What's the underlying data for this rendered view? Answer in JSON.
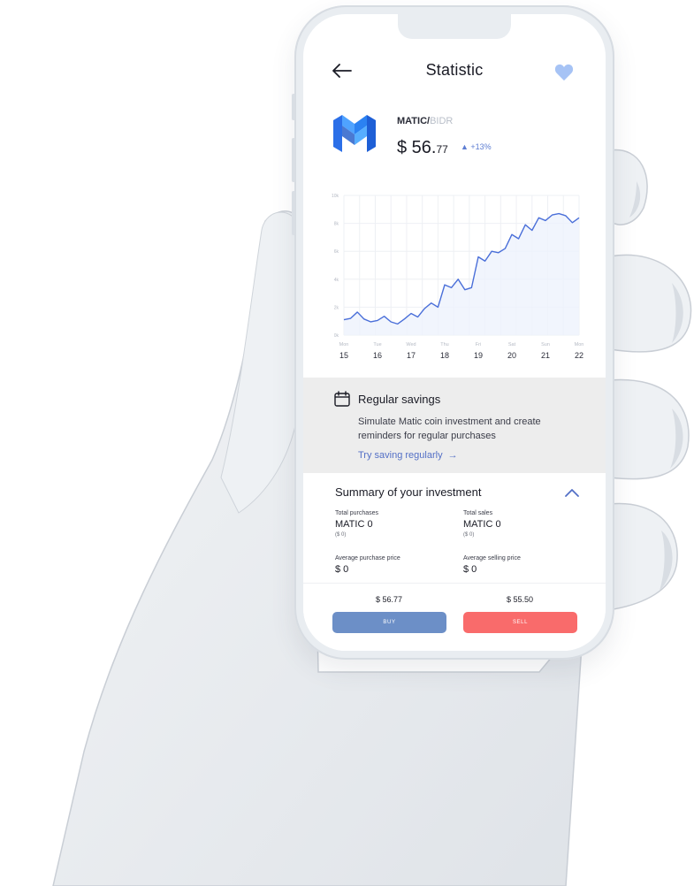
{
  "header": {
    "title": "Statistic",
    "back_icon": "arrow-left-icon",
    "favorite_icon": "heart-icon"
  },
  "coin": {
    "logo_icon": "matic-logo-icon",
    "base": "MATIC",
    "separator": "/",
    "quote": "BIDR",
    "price_main": "$ 56.",
    "price_decimal": "77",
    "change": "▲ +13%"
  },
  "chart_data": {
    "type": "line",
    "x": [
      "Mon 15",
      "Tue 16",
      "Wed 17",
      "Thu 18",
      "Fri 19",
      "Sat 20",
      "Sun 21",
      "Mon 22"
    ],
    "weekday_labels": [
      "Mon",
      "Tue",
      "Wed",
      "Thu",
      "Fri",
      "Sat",
      "Sun",
      "Mon"
    ],
    "day_labels": [
      "15",
      "16",
      "17",
      "18",
      "19",
      "20",
      "21",
      "22"
    ],
    "y_tick_labels": [
      "0k",
      "2k",
      "4k",
      "6k",
      "8k",
      "10k"
    ],
    "ylim": [
      0,
      10000
    ],
    "series": [
      {
        "color": "#4a6fd9",
        "x": [
          0,
          0.2,
          0.4,
          0.6,
          0.8,
          1.0,
          1.2,
          1.4,
          1.6,
          1.8,
          2.0,
          2.2,
          2.4,
          2.6,
          2.8,
          3.0,
          3.2,
          3.4,
          3.6,
          3.8,
          4.0,
          4.2,
          4.4,
          4.6,
          4.8,
          5.0,
          5.2,
          5.4,
          5.6,
          5.8,
          6.0,
          6.2,
          6.4,
          6.6,
          6.8,
          7.0
        ],
        "values": [
          1100,
          1200,
          1650,
          1150,
          950,
          1050,
          1350,
          950,
          800,
          1150,
          1550,
          1300,
          1900,
          2300,
          2000,
          3600,
          3400,
          4000,
          3250,
          3400,
          5600,
          5300,
          6000,
          5900,
          6200,
          7200,
          6900,
          7900,
          7500,
          8400,
          8200,
          8600,
          8700,
          8550,
          8050,
          8400
        ]
      }
    ],
    "grid": true,
    "legend": "none"
  },
  "savings": {
    "icon": "calendar-icon",
    "title": "Regular savings",
    "description": "Simulate Matic coin investment and create reminders for regular purchases",
    "link": "Try saving regularly",
    "link_icon": "arrow-right-icon"
  },
  "summary": {
    "title": "Summary of your investment",
    "toggle_icon": "chevron-up-icon",
    "total_purchases": {
      "label": "Total purchases",
      "value": "MATIC 0",
      "sub": "($ 0)"
    },
    "total_sales": {
      "label": "Total sales",
      "value": "MATIC 0",
      "sub": "($ 0)"
    },
    "avg_purchase": {
      "label": "Average purchase price",
      "value": "$ 0"
    },
    "avg_selling": {
      "label": "Average selling price",
      "value": "$ 0"
    }
  },
  "trade": {
    "buy_price": "$ 56.77",
    "sell_price": "$ 55.50",
    "buy_label": "BUY",
    "sell_label": "SELL"
  },
  "colors": {
    "accent": "#5470c6",
    "buy": "#6c8fc7",
    "sell": "#f96b6b",
    "chart_line": "#4a6fd9",
    "favorite": "#a6c3f5"
  }
}
